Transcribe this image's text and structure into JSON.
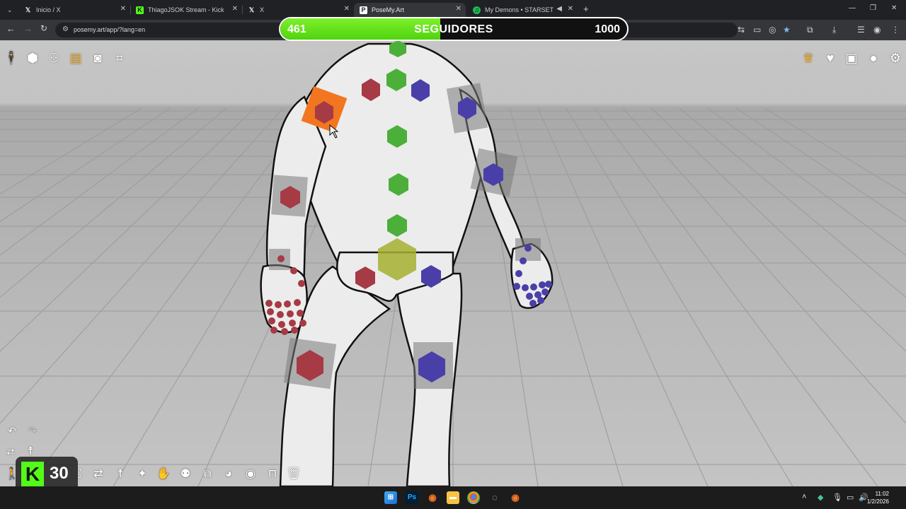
{
  "browser": {
    "tabs": [
      {
        "title": "Inicio / X",
        "icon": "x-logo",
        "active": false
      },
      {
        "title": "ThiagoJSOK Stream - Kick Dash",
        "icon": "kick-logo",
        "active": false
      },
      {
        "title": "X",
        "icon": "x-logo",
        "active": false
      },
      {
        "title": "PoseMy.Art",
        "icon": "posemyart-logo",
        "active": true
      },
      {
        "title": "My Demons • STARSET",
        "icon": "spotify-logo",
        "active": false
      }
    ],
    "url": "posemy.art/app/?lang=en"
  },
  "follower_goal": {
    "current": "461",
    "label": "SEGUIDORES",
    "goal": "1000",
    "progress": 0.461,
    "fill_color": "#62e61a"
  },
  "app": {
    "left_tools": [
      "figure-icon",
      "cube-icon",
      "multi-figure-icon",
      "export-file-icon",
      "camera-icon",
      "crop-icon"
    ],
    "right_tools": [
      "crown-icon",
      "heart-icon",
      "save-icon",
      "user-icon",
      "settings-icon"
    ],
    "bottom_tools": [
      "swap-icon",
      "figure-icon",
      "flip-icon",
      "stretch-pose-icon",
      "hand-icon",
      "group-icon",
      "copy-icon",
      "palette-icon",
      "eye-icon",
      "unlock-icon",
      "trash-icon"
    ]
  },
  "overlay": {
    "kick_number": "30"
  },
  "taskbar": {
    "time": "11:02",
    "date": "1/2/2026"
  },
  "colors": {
    "joint_left": "#a63a45",
    "joint_right": "#4a3fa8",
    "joint_center": "#4caf3a",
    "joint_selected": "#f27520",
    "joint_hip": "#a6b030"
  }
}
